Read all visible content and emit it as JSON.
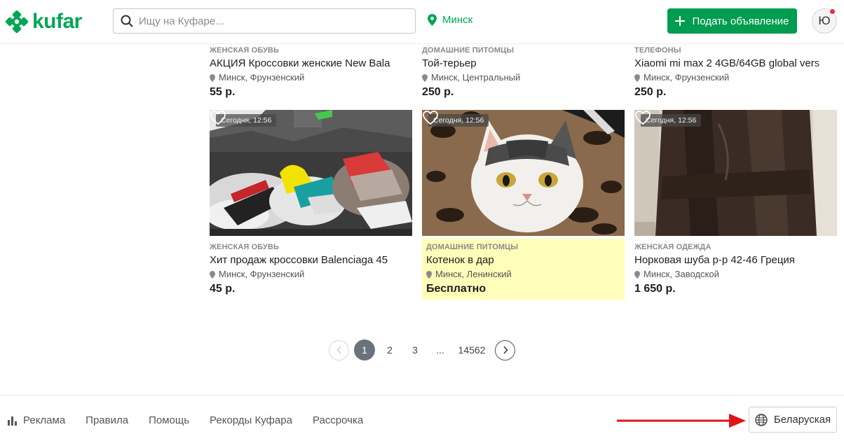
{
  "header": {
    "logo_text": "kufar",
    "search_placeholder": "Ищу на Куфаре...",
    "location": "Минск",
    "post_button": "Подать объявление",
    "avatar_letter": "Ю"
  },
  "top_row": [
    {
      "category": "ЖЕНСКАЯ ОБУВЬ",
      "title": "АКЦИЯ Кроссовки женские New Bala",
      "location": "Минск, Фрунзенский",
      "price": "55 р."
    },
    {
      "category": "ДОМАШНИЕ ПИТОМЦЫ",
      "title": "Той-терьер",
      "location": "Минск, Центральный",
      "price": "250 р."
    },
    {
      "category": "ТЕЛЕФОНЫ",
      "title": "Xiaomi mi max 2 4GB/64GB global vers",
      "location": "Минск, Фрунзенский",
      "price": "250 р."
    }
  ],
  "bottom_row": [
    {
      "time": "Сегодня, 12:56",
      "category": "ЖЕНСКАЯ ОБУВЬ",
      "title": "Хит продаж кроссовки Balenciaga 45",
      "location": "Минск, Фрунзенский",
      "price": "45 р.",
      "highlight": false,
      "image": "sneakers-photo"
    },
    {
      "time": "Сегодня, 12:56",
      "category": "ДОМАШНИЕ ПИТОМЦЫ",
      "title": "Котенок в дар",
      "location": "Минск, Ленинский",
      "price": "Бесплатно",
      "highlight": true,
      "image": "kitten-photo"
    },
    {
      "time": "Сегодня, 12:56",
      "category": "ЖЕНСКАЯ ОДЕЖДА",
      "title": "Норковая шуба р-р 42-46 Греция",
      "location": "Минск, Заводской",
      "price": "1 650 р.",
      "highlight": false,
      "image": "fur-coat-photo"
    }
  ],
  "pagination": {
    "pages": [
      "1",
      "2",
      "3",
      "...",
      "14562"
    ],
    "current": "1"
  },
  "footer": {
    "links": [
      "Реклама",
      "Правила",
      "Помощь",
      "Рекорды Куфара",
      "Рассрочка"
    ],
    "language_button": "Беларуская"
  },
  "colors": {
    "brand_green": "#00a753",
    "button_green": "#009c4f",
    "highlight_yellow": "#fefdb9",
    "annotation_red": "#e0151b"
  }
}
